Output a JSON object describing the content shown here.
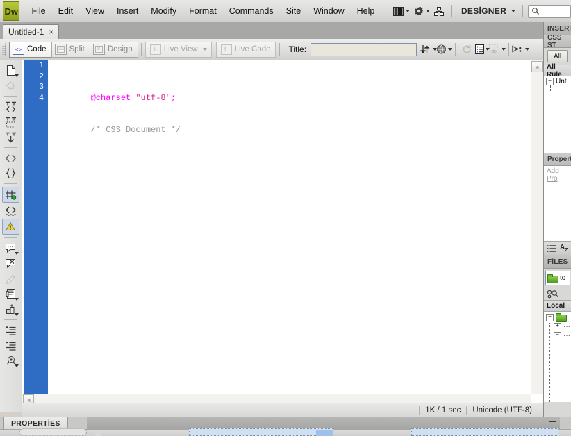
{
  "app": {
    "name": "Dreamweaver",
    "logo_text": "Dw",
    "workspace": "DESİGNER"
  },
  "menubar": {
    "items": [
      {
        "label": "File"
      },
      {
        "label": "Edit"
      },
      {
        "label": "View"
      },
      {
        "label": "Insert"
      },
      {
        "label": "Modify"
      },
      {
        "label": "Format"
      },
      {
        "label": "Commands"
      },
      {
        "label": "Site"
      },
      {
        "label": "Window"
      },
      {
        "label": "Help"
      }
    ],
    "icons": [
      {
        "name": "layout-switcher-icon"
      },
      {
        "name": "gear-icon"
      },
      {
        "name": "site-map-icon"
      }
    ],
    "search_placeholder": ""
  },
  "document_tabs": [
    {
      "label": "Untitled-1",
      "close": "×",
      "active": true
    }
  ],
  "doc_toolbar": {
    "view_buttons": [
      {
        "label": "Code",
        "active": true
      },
      {
        "label": "Split",
        "active": false
      },
      {
        "label": "Design",
        "active": false
      }
    ],
    "live_view": "Live View",
    "live_code": "Live Code",
    "title_label": "Title:",
    "title_value": "",
    "icons": [
      {
        "name": "file-management-icon"
      },
      {
        "name": "preview-in-browser-icon"
      },
      {
        "name": "refresh-icon"
      },
      {
        "name": "view-options-icon"
      },
      {
        "name": "visual-aids-icon"
      },
      {
        "name": "live-view-options-icon"
      }
    ]
  },
  "coding_toolbar": {
    "items": [
      {
        "name": "open-documents-icon"
      },
      {
        "name": "show-code-navigator-icon"
      },
      {
        "name": "collapse-full-tag-icon"
      },
      {
        "name": "collapse-selection-icon"
      },
      {
        "name": "expand-all-icon"
      },
      {
        "name": "select-parent-tag-icon"
      },
      {
        "name": "balance-braces-icon"
      },
      {
        "name": "line-numbers-icon"
      },
      {
        "name": "highlight-invalid-code-icon"
      },
      {
        "name": "syntax-error-alerts-icon"
      },
      {
        "name": "apply-comment-icon"
      },
      {
        "name": "remove-comment-icon"
      },
      {
        "name": "wrap-tag-icon"
      },
      {
        "name": "recent-snippets-icon"
      },
      {
        "name": "move-css-rules-icon"
      },
      {
        "name": "indent-code-icon"
      },
      {
        "name": "outdent-code-icon"
      },
      {
        "name": "format-source-code-icon"
      }
    ]
  },
  "editor": {
    "line_numbers": [
      "1",
      "2",
      "3",
      "4"
    ],
    "lines": [
      {
        "tokens": [
          {
            "text": "@charset ",
            "type": "at"
          },
          {
            "text": "\"utf-8\"",
            "type": "str"
          },
          {
            "text": ";",
            "type": "at"
          }
        ]
      },
      {
        "tokens": [
          {
            "text": "/* CSS Document */",
            "type": "comment"
          }
        ]
      },
      {
        "tokens": []
      },
      {
        "tokens": []
      }
    ],
    "scroll_up": "▲",
    "scroll_left": "◄"
  },
  "statusbar": {
    "size_time": "1K / 1 sec",
    "encoding": "Unicode (UTF-8)"
  },
  "right_panel": {
    "insert_tab": "INSERT",
    "css_styles_header": "CSS ST",
    "all_button": "All",
    "all_rules_header": "All Rule",
    "rule_node": "Unt",
    "properties_header": "Propert",
    "add_property": "Add Pro",
    "sort_icons": [
      {
        "name": "category-view-icon"
      },
      {
        "name": "alphabetical-view-icon"
      }
    ],
    "files_tab": "FİLES",
    "site_name": "to",
    "local_files_header": "Local",
    "tree_nodes": [
      "−",
      "+",
      "−"
    ]
  },
  "properties_panel": {
    "tab_label": "PROPERTİES"
  }
}
